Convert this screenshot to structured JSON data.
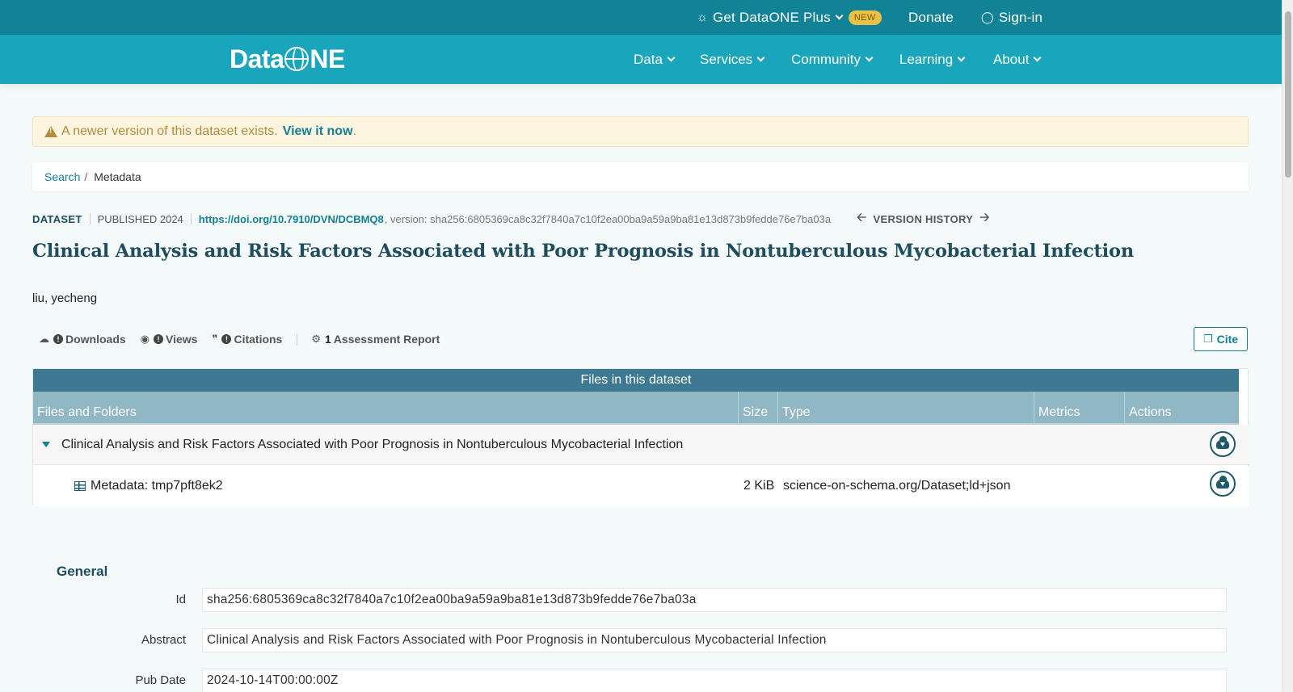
{
  "topbar": {
    "plus_label": "Get DataONE Plus",
    "new_badge": "NEW",
    "donate": "Donate",
    "signin": "Sign-in"
  },
  "brand": {
    "logo_text_data": "Data",
    "logo_text_ne": "NE"
  },
  "nav": {
    "items": [
      {
        "label": "Data"
      },
      {
        "label": "Services"
      },
      {
        "label": "Community"
      },
      {
        "label": "Learning"
      },
      {
        "label": "About"
      }
    ]
  },
  "alert": {
    "message": "A newer version of this dataset exists.",
    "link": "View it now",
    "suffix": "."
  },
  "breadcrumb": {
    "search": "Search",
    "separator": "/",
    "current": "Metadata"
  },
  "dataset": {
    "type": "DATASET",
    "published": "PUBLISHED 2024",
    "doi": "https://doi.org/10.7910/DVN/DCBMQ8",
    "version": ", version: sha256:6805369ca8c32f7840a7c10f2ea00ba9a59a9ba81e13d873b9fedde76e7ba03a",
    "version_history": "VERSION HISTORY",
    "title": "Clinical Analysis and Risk Factors Associated with Poor Prognosis in Nontuberculous Mycobacterial Infection",
    "author": "liu, yecheng"
  },
  "metrics": {
    "downloads": "Downloads",
    "views": "Views",
    "citations": "Citations",
    "assessment_count": "1",
    "assessment": "Assessment Report",
    "cite": "Cite"
  },
  "files": {
    "caption": "Files in this dataset",
    "columns": [
      "Files and Folders",
      "Size",
      "Type",
      "Metrics",
      "Actions"
    ],
    "rows": [
      {
        "name": "Clinical Analysis and Risk Factors Associated with Poor Prognosis in Nontuberculous Mycobacterial Infection",
        "size": "",
        "type": ""
      },
      {
        "name": "Metadata: tmp7pft8ek2",
        "size": "2 KiB",
        "type": "science-on-schema.org/Dataset;ld+json"
      }
    ]
  },
  "general": {
    "heading": "General",
    "fields": [
      {
        "label": "Id",
        "value": "sha256:6805369ca8c32f7840a7c10f2ea00ba9a59a9ba81e13d873b9fedde76e7ba03a"
      },
      {
        "label": "Abstract",
        "value": "Clinical Analysis and Risk Factors Associated with Poor Prognosis in Nontuberculous Mycobacterial Infection"
      },
      {
        "label": "Pub Date",
        "value": "2024-10-14T00:00:00Z"
      }
    ]
  },
  "colors": {
    "topbar": "#128397",
    "nav": "#19a6bd",
    "accent": "#137f94",
    "title": "#1e4d5e",
    "table_caption": "#3d7a91",
    "table_head": "#8fb7c4"
  }
}
